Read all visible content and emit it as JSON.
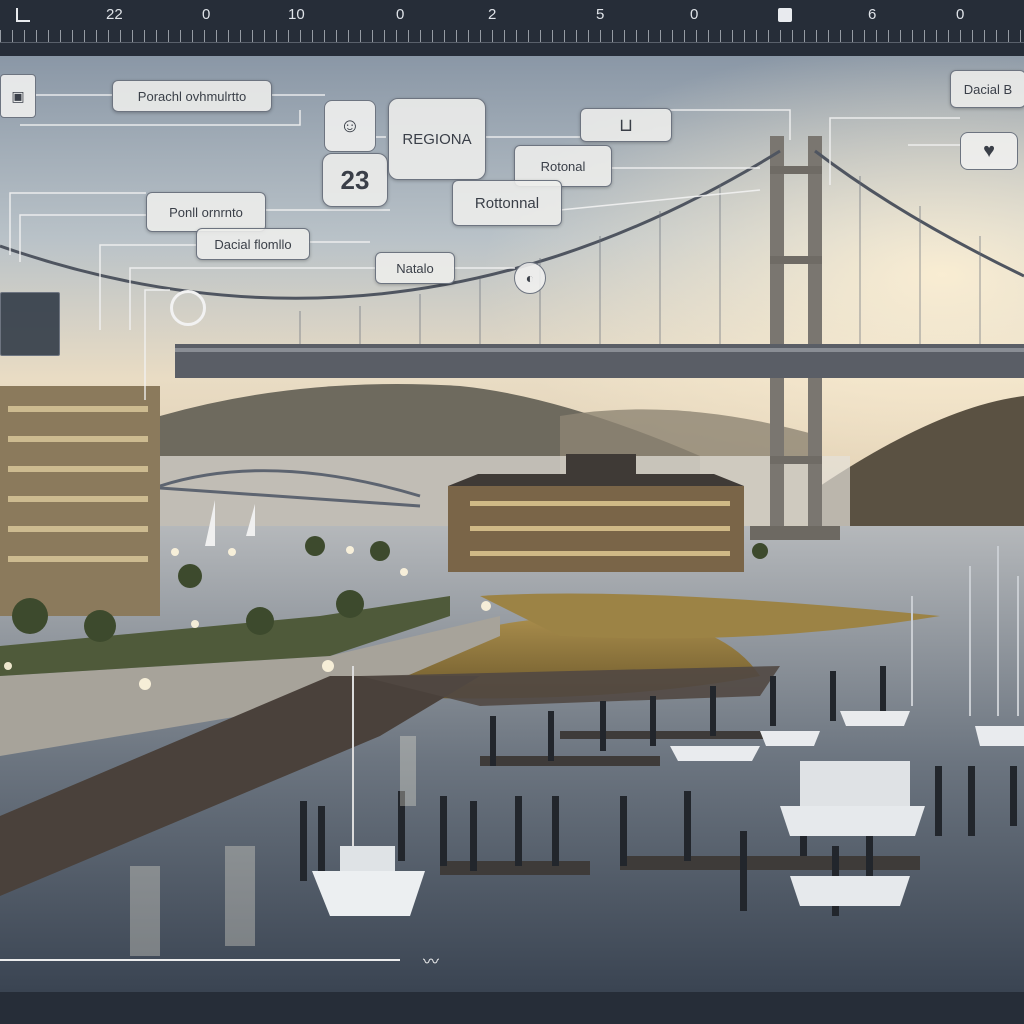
{
  "ruler": {
    "labels": [
      "22",
      "0",
      "10",
      "0",
      "2",
      "5",
      "0",
      "6",
      "0"
    ]
  },
  "callouts": {
    "top_left": "Porachl ovhmulrtto",
    "regiona": "REGIONA",
    "number": "23",
    "rotonal": "Rotonal",
    "rottonnal": "Rottonnal",
    "ponl": "Ponll ornrnto",
    "dacial": "Dacial flomllo",
    "natalo": "Natalo",
    "top_right": "Dacial B"
  },
  "icons": {
    "doc_top_left": "document-icon",
    "face": "face-icon",
    "pin": "pin-icon",
    "ring": "ring-icon",
    "heart": "heart-icon",
    "bracket": "bracket-icon",
    "ruler_square": "square-icon",
    "scribble": "scribble-icon"
  },
  "colors": {
    "chrome": "#262d38",
    "callout_bg": "#eeeeec",
    "callout_border": "#6d7480",
    "line": "#f2f2f2"
  }
}
